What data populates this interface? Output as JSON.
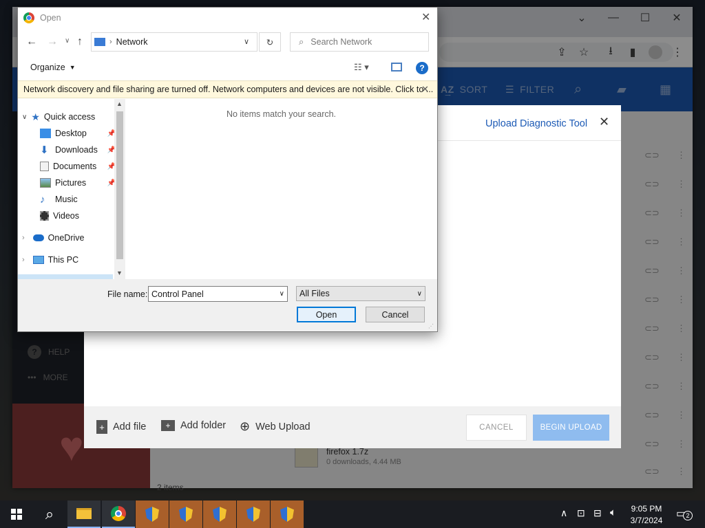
{
  "browser": {
    "toolbar_icons": [
      "share-icon",
      "star-icon",
      "download-icon",
      "side-panel-icon",
      "profile-icon",
      "menu-icon"
    ]
  },
  "app": {
    "toolbar": {
      "sort": "SORT",
      "filter": "FILTER"
    },
    "sidebar": {
      "help": "HELP",
      "more": "MORE"
    },
    "file_item": {
      "name": "firefox 1.7z",
      "meta": "0 downloads, 4.44 MB"
    },
    "status": "2 items"
  },
  "upload_modal": {
    "header_link": "Upload Diagnostic Tool",
    "add_file": "Add file",
    "add_folder": "Add folder",
    "web_upload": "Web Upload",
    "cancel": "CANCEL",
    "begin_upload": "BEGIN UPLOAD"
  },
  "open_dialog": {
    "title": "Open",
    "breadcrumb": "Network",
    "search_placeholder": "Search Network",
    "organize": "Organize",
    "info_bar": "Network discovery and file sharing are turned off. Network computers and devices are not visible. Click to ...",
    "empty_message": "No items match your search.",
    "nav": {
      "quick_access": "Quick access",
      "items": [
        {
          "label": "Desktop",
          "icon": "desktop-icon",
          "pinned": true
        },
        {
          "label": "Downloads",
          "icon": "download-folder-icon",
          "pinned": true
        },
        {
          "label": "Documents",
          "icon": "documents-icon",
          "pinned": true
        },
        {
          "label": "Pictures",
          "icon": "pictures-icon",
          "pinned": true
        },
        {
          "label": "Music",
          "icon": "music-icon",
          "pinned": false
        },
        {
          "label": "Videos",
          "icon": "videos-icon",
          "pinned": false
        }
      ],
      "onedrive": "OneDrive",
      "this_pc": "This PC"
    },
    "file_name_label": "File name:",
    "file_name_value": "Control Panel",
    "file_type": "All Files",
    "open_button": "Open",
    "cancel_button": "Cancel"
  },
  "taskbar": {
    "time": "9:05 PM",
    "date": "3/7/2024",
    "notification_count": "2",
    "apps": [
      "file-explorer-icon",
      "chrome-icon",
      "uac-shield-icon",
      "uac-shield-icon",
      "uac-shield-icon",
      "uac-shield-icon",
      "uac-shield-icon"
    ]
  },
  "colors": {
    "accent": "#1c5ab5",
    "info_bar": "#fff8dd",
    "begin_upload": "#8fbcef"
  }
}
